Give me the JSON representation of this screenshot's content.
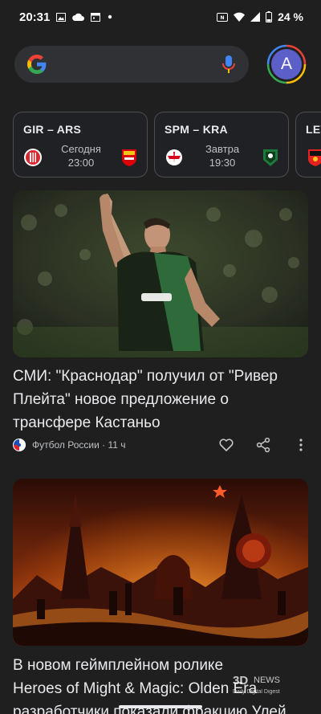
{
  "status_bar": {
    "time": "20:31",
    "battery": "24 %",
    "left_icons": [
      "image-icon",
      "cloud-icon",
      "calendar-icon",
      "dot-icon"
    ],
    "right_icons": [
      "nfc-icon",
      "wifi-icon",
      "signal-icon",
      "battery-icon"
    ]
  },
  "search": {
    "logo": "google-logo-icon",
    "mic": "mic-icon"
  },
  "account": {
    "initial": "A"
  },
  "scores": [
    {
      "title": "GIR – ARS",
      "day": "Сегодня",
      "time": "23:00",
      "home_logo": "girona-logo-icon",
      "away_logo": "arsenal-logo-icon"
    },
    {
      "title": "SPM – KRA",
      "day": "Завтра",
      "time": "19:30",
      "home_logo": "spartak-logo-icon",
      "away_logo": "krasnodar-logo-icon"
    },
    {
      "title": "LEV",
      "day": "",
      "time": "",
      "home_logo": "leverkusen-logo-icon",
      "away_logo": ""
    }
  ],
  "articles": [
    {
      "title_line1": "СМИ: \"Краснодар\" получил от \"Ривер",
      "title_line2": "Плейта\" новое предложение о",
      "title_line3": "трансфере Кастаньо",
      "source": "Футбол России · 11 ч",
      "image": "football-player-photo"
    },
    {
      "title_line1": "В новом геймплейном ролике",
      "title_line2": "Heroes of Might & Magic: Olden Era",
      "title_line3": "разработчики показали фракцию Улей",
      "image": "fantasy-city-artwork"
    }
  ],
  "watermark": "3DNEWS Daily Digital Digest",
  "colors": {
    "background": "#1f1f1f",
    "card_border": "#4a4d51",
    "search_bg": "#303134",
    "avatar": "#5b5fc7"
  }
}
